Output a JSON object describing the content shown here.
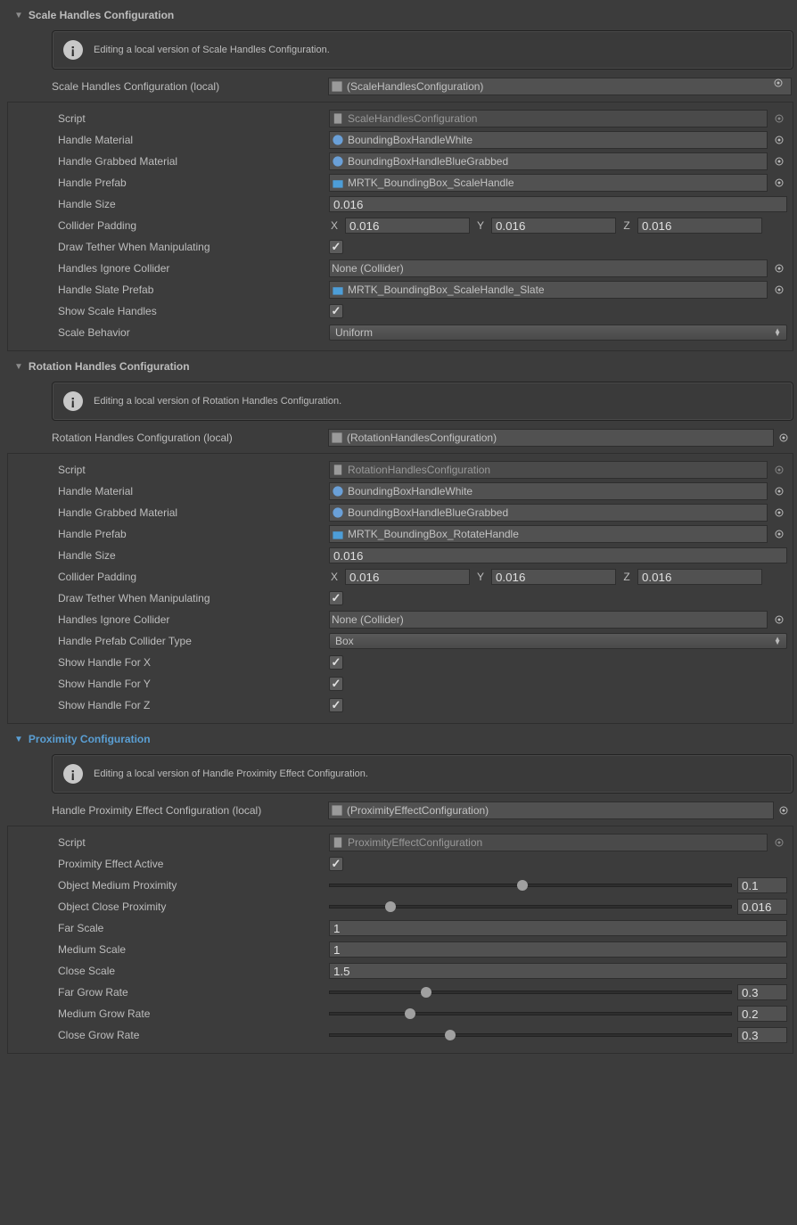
{
  "scale": {
    "header": "Scale Handles Configuration",
    "info": "Editing a local version of Scale Handles Configuration.",
    "conf_label": "Scale Handles Configuration (local)",
    "conf_value": "(ScaleHandlesConfiguration)",
    "script_label": "Script",
    "script_value": "ScaleHandlesConfiguration",
    "mat_label": "Handle Material",
    "mat_value": "BoundingBoxHandleWhite",
    "gmat_label": "Handle Grabbed Material",
    "gmat_value": "BoundingBoxHandleBlueGrabbed",
    "prefab_label": "Handle Prefab",
    "prefab_value": "MRTK_BoundingBox_ScaleHandle",
    "size_label": "Handle Size",
    "size_value": "0.016",
    "pad_label": "Collider Padding",
    "pad_x": "0.016",
    "pad_y": "0.016",
    "pad_z": "0.016",
    "tether_label": "Draw Tether When Manipulating",
    "ignore_label": "Handles Ignore Collider",
    "ignore_value": "None (Collider)",
    "slate_label": "Handle Slate Prefab",
    "slate_value": "MRTK_BoundingBox_ScaleHandle_Slate",
    "show_label": "Show Scale Handles",
    "behavior_label": "Scale Behavior",
    "behavior_value": "Uniform",
    "axis_x": "X",
    "axis_y": "Y",
    "axis_z": "Z"
  },
  "rotation": {
    "header": "Rotation Handles Configuration",
    "info": "Editing a local version of Rotation Handles Configuration.",
    "conf_label": "Rotation Handles Configuration (local)",
    "conf_value": "(RotationHandlesConfiguration)",
    "script_label": "Script",
    "script_value": "RotationHandlesConfiguration",
    "mat_label": "Handle Material",
    "mat_value": "BoundingBoxHandleWhite",
    "gmat_label": "Handle Grabbed Material",
    "gmat_value": "BoundingBoxHandleBlueGrabbed",
    "prefab_label": "Handle Prefab",
    "prefab_value": "MRTK_BoundingBox_RotateHandle",
    "size_label": "Handle Size",
    "size_value": "0.016",
    "pad_label": "Collider Padding",
    "pad_x": "0.016",
    "pad_y": "0.016",
    "pad_z": "0.016",
    "tether_label": "Draw Tether When Manipulating",
    "ignore_label": "Handles Ignore Collider",
    "ignore_value": "None (Collider)",
    "ctype_label": "Handle Prefab Collider Type",
    "ctype_value": "Box",
    "showx_label": "Show Handle For X",
    "showy_label": "Show Handle For Y",
    "showz_label": "Show Handle For Z",
    "axis_x": "X",
    "axis_y": "Y",
    "axis_z": "Z"
  },
  "proximity": {
    "header": "Proximity Configuration",
    "info": "Editing a local version of Handle Proximity Effect Configuration.",
    "conf_label": "Handle Proximity Effect Configuration (local)",
    "conf_value": "(ProximityEffectConfiguration)",
    "script_label": "Script",
    "script_value": "ProximityEffectConfiguration",
    "active_label": "Proximity Effect Active",
    "med_label": "Object Medium Proximity",
    "med_value": "0.1",
    "close_label": "Object Close Proximity",
    "close_value": "0.016",
    "farscale_label": "Far Scale",
    "farscale_value": "1",
    "medscale_label": "Medium Scale",
    "medscale_value": "1",
    "closescale_label": "Close Scale",
    "closescale_value": "1.5",
    "fargrow_label": "Far Grow Rate",
    "fargrow_value": "0.3",
    "medgrow_label": "Medium Grow Rate",
    "medgrow_value": "0.2",
    "closegrow_label": "Close Grow Rate",
    "closegrow_value": "0.3"
  }
}
